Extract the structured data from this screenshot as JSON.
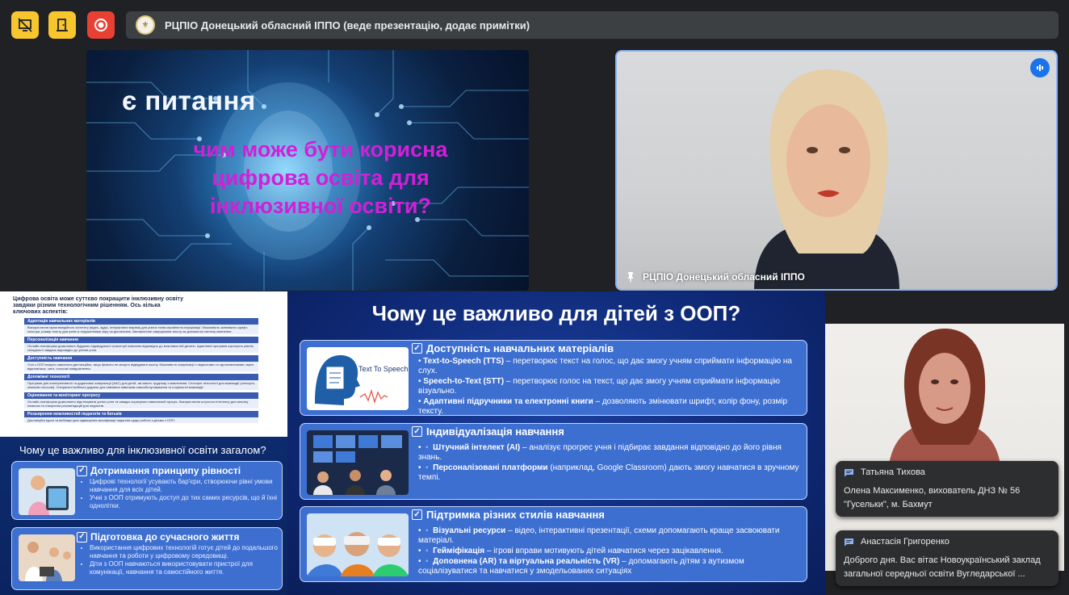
{
  "topbar": {
    "presenter_banner": "РЦПІО Донецький обласний ІППО (веде презентацію, додає примітки)",
    "colors": {
      "yellow": "#f7c52e",
      "red": "#e84134"
    }
  },
  "main_slide": {
    "question": "є питання",
    "subtitle": "чим може бути корисна цифрова освіта для інклюзивної освіти?"
  },
  "speaker_tile": {
    "name": "РЦПІО Донецький обласний ІППО"
  },
  "left_slide": {
    "intro": "Цифрова освіта може суттєво покращити інклюзивну освіту завдяки різним технологічним рішенням. Ось кілька ключових аспектів:",
    "sections": [
      {
        "title": "Адаптація навчальних матеріалів",
        "text": "Використання мультимедійного контенту (відео, аудіо, інтерактивні вправи) для різних типів сприйняття інформації. Можливість змінювати шрифт, кольори, розмір тексту для учнів із порушеннями зору чи дислексією. Автоматичне озвучування тексту за допомогою синтезу мовлення."
      },
      {
        "title": "Персоналізація навчання",
        "text": "Онлайн-платформи дозволяють будувати індивідуальні траєкторії навчання відповідно до можливостей дитини. Адаптивні програми коригують рівень складності завдань відповідно до успіхів учня."
      },
      {
        "title": "Доступність навчання",
        "text": "Учні з ООП можуть навчатися дистанційно, якщо фізично не можуть відвідувати школу. Можливість комунікації з педагогами та однокласниками через відеозв'язок, чати, голосові повідомлення."
      },
      {
        "title": "Допоміжні технології",
        "text": "Програми для альтернативної та додаткової комунікації (AAC) для дітей, які мають труднощі з мовленням. Сенсорні технології для взаємодії (сенсорні, кнопкові голосові). Спеціальні мобільні додатки для навчання навичкам самообслуговування та соціальної взаємодії."
      },
      {
        "title": "Оцінювання та моніторинг прогресу",
        "text": "Онлайн-платформи дозволяють відстежувати успіхи учня та швидко коригувати навчальний процес. Використання штучного інтелекту для аналізу помилок та створення рекомендацій для педагогів."
      },
      {
        "title": "Розширення можливостей педагогів та батьків",
        "text": "Дистанційні курси та вебінари для підвищення кваліфікації педагогів щодо роботи з дітьми з ООП."
      }
    ]
  },
  "left_panel": {
    "title": "Чому це важливо для інклюзивної освіти загалом?",
    "cards": [
      {
        "title": "Дотримання принципу рівності",
        "items": [
          "Цифрові технології усувають бар'єри, створюючи рівні умови навчання для всіх дітей.",
          "Учні з ООП отримують доступ до тих самих ресурсів, що й їхні однолітки."
        ]
      },
      {
        "title": "Підготовка до сучасного життя",
        "items": [
          "Використання цифрових технологій готує дітей до подальшого навчання та роботи у цифровому середовищі.",
          "Діти з ООП навчаються використовувати пристрої для комунікації, навчання та самостійного життя."
        ]
      }
    ]
  },
  "center_slide": {
    "title": "Чому це важливо для дітей з ООП?",
    "tts_label": "Text To Speech",
    "cards": [
      {
        "title": "Доступність навчальних матеріалів",
        "items": [
          {
            "bold": "Text-to-Speech (TTS)",
            "text": " – перетворює текст на голос, що дає змогу учням сприймати інформацію на слух."
          },
          {
            "bold": "Speech-to-Text (STT)",
            "text": " – перетворює голос на текст, що дає змогу учням сприймати інформацію візуально."
          },
          {
            "bold": "Адаптивні підручники та електронні книги",
            "text": " – дозволяють змінювати шрифт, колір фону, розмір тексту."
          }
        ]
      },
      {
        "title": "Індивідуалізація навчання",
        "items": [
          {
            "bold": "Штучний інтелект (AI)",
            "text": " – аналізує прогрес учня і підбирає завдання відповідно до його рівня знань."
          },
          {
            "bold": "Персоналізовані платформи",
            "text": " (наприклад, Google Classroom) дають змогу навчатися в зручному темпі."
          }
        ]
      },
      {
        "title": "Підтримка різних стилів навчання",
        "items": [
          {
            "bold": "Візуальні ресурси",
            "text": " – відео, інтерактивні презентації, схеми допомагають краще засвоювати матеріал."
          },
          {
            "bold": "Гейміфікація",
            "text": " – ігрові вправи мотивують дітей навчатися через зацікавлення."
          },
          {
            "bold": "Доповнена (AR) та віртуальна реальність (VR)",
            "text": " – допомагають дітям з аутизмом соціалізуватися та навчатися у змодельованих ситуаціях"
          }
        ]
      }
    ]
  },
  "chat_toasts": [
    {
      "name": "Татьяна Тихова",
      "message": "Олена Максименко, вихователь ДНЗ № 56 \"Гусельки\", м. Бахмут"
    },
    {
      "name": "Анастасія Григоренко",
      "message": "Доброго дня. Вас вітає Новоукраїнський заклад загальної середньої освіти Вугледарської ..."
    }
  ]
}
